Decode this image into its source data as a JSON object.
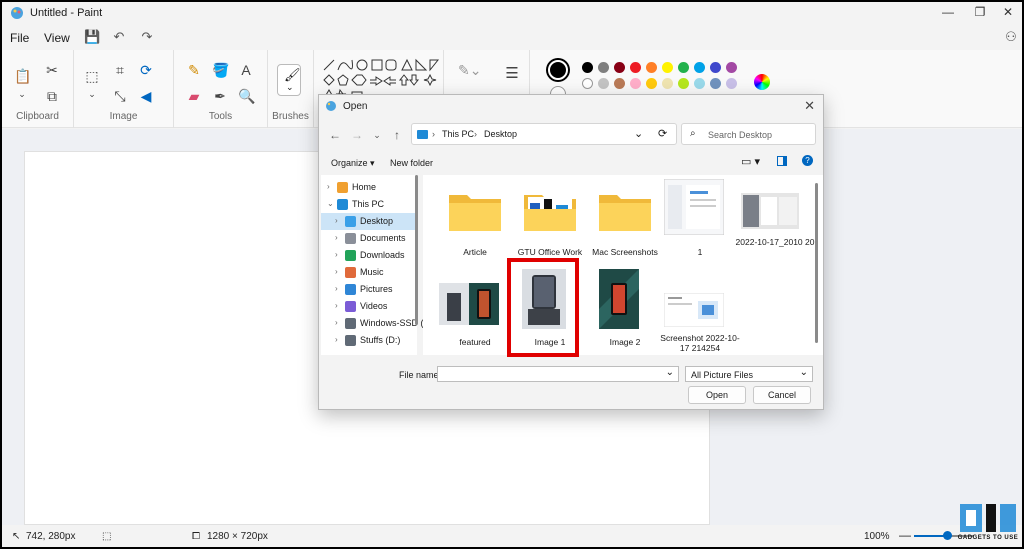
{
  "window": {
    "title": "Untitled - Paint"
  },
  "menu": {
    "file": "File",
    "view": "View"
  },
  "ribbon": {
    "groups": {
      "clipboard": "Clipboard",
      "image": "Image",
      "tools": "Tools",
      "brushes": "Brushes"
    },
    "palette_row1": [
      "#000000",
      "#7f7f7f",
      "#880015",
      "#ed1c24",
      "#ff7f27",
      "#fff200",
      "#22b14c",
      "#00a2e8",
      "#3f48cc",
      "#a349a4"
    ],
    "palette_row2": [
      "#ffffff",
      "#c3c3c3",
      "#b97a57",
      "#ffaec9",
      "#ffc90e",
      "#efe4b0",
      "#b5e61d",
      "#99d9ea",
      "#7092be",
      "#c8bfe7"
    ]
  },
  "dialog": {
    "title": "Open",
    "breadcrumb": [
      "This PC",
      "Desktop"
    ],
    "search_placeholder": "Search Desktop",
    "organize": "Organize",
    "new_folder": "New folder",
    "nav_items": [
      {
        "label": "Home",
        "icon": "home-icon"
      },
      {
        "label": "This PC",
        "icon": "pc-icon"
      },
      {
        "label": "Desktop",
        "icon": "desktop-icon",
        "selected": true
      },
      {
        "label": "Documents",
        "icon": "documents-icon"
      },
      {
        "label": "Downloads",
        "icon": "downloads-icon"
      },
      {
        "label": "Music",
        "icon": "music-icon"
      },
      {
        "label": "Pictures",
        "icon": "pictures-icon"
      },
      {
        "label": "Videos",
        "icon": "videos-icon"
      },
      {
        "label": "Windows-SSD (C",
        "icon": "drive-icon"
      },
      {
        "label": "Stuffs (D:)",
        "icon": "drive-icon"
      }
    ],
    "files": [
      {
        "label": "Article",
        "type": "folder"
      },
      {
        "label": "GTU Office Work",
        "type": "folder"
      },
      {
        "label": "Mac Screenshots",
        "type": "folder"
      },
      {
        "label": "1",
        "type": "image"
      },
      {
        "label": "2022-10-17_2010 20",
        "type": "image"
      },
      {
        "label": "featured",
        "type": "image"
      },
      {
        "label": "Image 1",
        "type": "image",
        "highlighted": true
      },
      {
        "label": "Image 2",
        "type": "image"
      },
      {
        "label": "Screenshot 2022-10-17 214254",
        "type": "image"
      }
    ],
    "file_name_label": "File name:",
    "file_name_value": "",
    "file_type": "All Picture Files",
    "open_button": "Open",
    "cancel_button": "Cancel"
  },
  "status": {
    "cursor_pos": "742, 280px",
    "canvas_size": "1280 × 720px",
    "zoom": "100%",
    "zoom_fraction": 0.55
  },
  "logo": {
    "text": "GADGETS TO USE"
  }
}
